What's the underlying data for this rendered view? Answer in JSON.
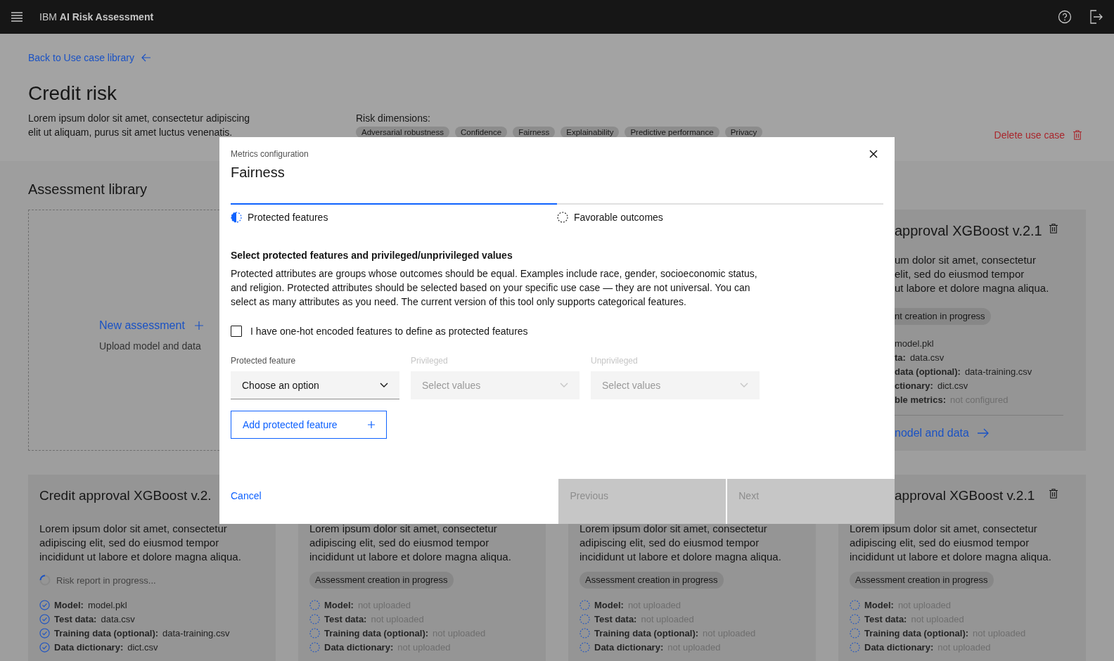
{
  "header": {
    "brand": "IBM **AI Risk Assessment**"
  },
  "page": {
    "back_link": "Back to Use case library",
    "title": "Credit risk",
    "description": "Lorem ipsum dolor sit amet, consectetur adipiscing elit ut aliquam, purus sit amet luctus venenatis.",
    "risk_label": "Risk dimensions:",
    "risk_tags": [
      "Adversarial robustness",
      "Confidence",
      "Fairness",
      "Explainability",
      "Predictive performance",
      "Privacy"
    ],
    "delete_button": "Delete use case"
  },
  "library": {
    "title": "Assessment library",
    "top_cards": [
      {
        "kind": "new",
        "title": "New assessment",
        "subtitle": "Upload model and data"
      },
      {
        "kind": "assessment",
        "title": "approval XGBoost v.2.1",
        "description_lines": [
          "um dolor sit amet, consectetur",
          "elit, sed do eiusmod tempor",
          "ut labore et dolore magna aliqua."
        ],
        "status": {
          "kind": "tag",
          "text": "nt creation in progress"
        },
        "items": [
          {
            "value": "model.pkl",
            "uploaded": true
          },
          {
            "label": "ta:",
            "value": "data.csv",
            "uploaded": true
          },
          {
            "label": "data (optional):",
            "value": "data-training.csv",
            "uploaded": true
          },
          {
            "label": "ctionary:",
            "value": "dict.csv",
            "uploaded": true
          },
          {
            "label": "ble metrics:",
            "value": "not configured",
            "uploaded": false
          }
        ],
        "link": "nodel and data"
      }
    ],
    "bottom_cards": [
      {
        "title": "Credit approval XGBoost v.2.",
        "description": "Lorem ipsum dolor sit amet, consectetur adipiscing elit, sed do eiusmod tempor incididunt ut labore et dolore magna aliqua.",
        "status": {
          "kind": "spinner",
          "text": "Risk report in progress..."
        },
        "items": [
          {
            "label": "Model:",
            "value": "model.pkl",
            "uploaded": true
          },
          {
            "label": "Test data:",
            "value": "data.csv",
            "uploaded": true
          },
          {
            "label": "Training data (optional):",
            "value": "data-training.csv",
            "uploaded": true
          },
          {
            "label": "Data dictionary:",
            "value": "dict.csv",
            "uploaded": true
          }
        ]
      },
      {
        "description": "Lorem ipsum dolor sit amet, consectetur adipiscing elit, sed do eiusmod tempor incididunt ut labore et dolore magna aliqua.",
        "status": {
          "kind": "tag",
          "text": "Assessment creation in progress"
        },
        "items": [
          {
            "label": "Model:",
            "value": "not uploaded",
            "uploaded": false
          },
          {
            "label": "Test data:",
            "value": "not uploaded",
            "uploaded": false
          },
          {
            "label": "Training data (optional):",
            "value": "not uploaded",
            "uploaded": false
          },
          {
            "label": "Data dictionary:",
            "value": "not uploaded",
            "uploaded": false
          }
        ]
      },
      {
        "description": "Lorem ipsum dolor sit amet, consectetur adipiscing elit, sed do eiusmod tempor incididunt ut labore et dolore magna aliqua.",
        "status": {
          "kind": "tag",
          "text": "Assessment creation in progress"
        },
        "items": [
          {
            "label": "Model:",
            "value": "not uploaded",
            "uploaded": false
          },
          {
            "label": "Test data:",
            "value": "not uploaded",
            "uploaded": false
          },
          {
            "label": "Training data (optional):",
            "value": "not uploaded",
            "uploaded": false
          },
          {
            "label": "Data dictionary:",
            "value": "not uploaded",
            "uploaded": false
          }
        ]
      },
      {
        "title": "approval XGBoost v.2.1",
        "description": "Lorem ipsum dolor sit amet, consectetur adipiscing elit, sed do eiusmod tempor incididunt ut labore et dolore magna aliqua.",
        "status": {
          "kind": "tag",
          "text": "Assessment creation in progress"
        },
        "items": [
          {
            "label": "Model:",
            "value": "not uploaded",
            "uploaded": false
          },
          {
            "label": "Test data:",
            "value": "not uploaded",
            "uploaded": false
          },
          {
            "label": "Training data (optional):",
            "value": "not uploaded",
            "uploaded": false
          },
          {
            "label": "Data dictionary:",
            "value": "not uploaded",
            "uploaded": false
          }
        ]
      }
    ]
  },
  "modal": {
    "eyebrow": "Metrics configuration",
    "title": "Fairness",
    "steps": [
      {
        "label": "Protected features",
        "selected": true
      },
      {
        "label": "Favorable outcomes",
        "selected": false
      }
    ],
    "heading": "Select protected features and privileged/unprivileged values",
    "body": "Protected attributes are groups whose outcomes should be equal. Examples include race, gender, socioeconomic status, and religion. Protected attributes should be selected based on your specific use case — they are not universal. You can select as many attributes as you need. The current version of this tool only supports categorical features.",
    "checkbox": {
      "label": "I have one-hot encoded features to define as protected features",
      "checked": false
    },
    "dropdowns": [
      {
        "label": "Protected feature",
        "text": "Choose an option",
        "disabled": false
      },
      {
        "label": "Privileged",
        "text": "Select values",
        "disabled": true
      },
      {
        "label": "Unprivileged",
        "text": "Select values",
        "disabled": true
      }
    ],
    "add_button": "Add protected feature",
    "footer": {
      "cancel": "Cancel",
      "buttons": [
        {
          "label": "Previous",
          "disabled": true
        },
        {
          "label": "Next",
          "disabled": true
        }
      ]
    }
  }
}
